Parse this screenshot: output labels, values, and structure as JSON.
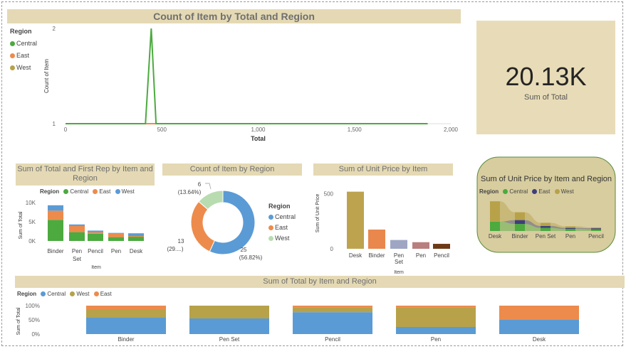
{
  "colors": {
    "central": "#5a9bd5",
    "east": "#ed8b4c",
    "west": "#b7a24a",
    "line_central": "#4caa3f",
    "line_east": "#ed8b4c",
    "line_west": "#b7a24a",
    "titlebar": "#e4d9b4"
  },
  "legend_title": "Region",
  "regions": [
    "Central",
    "East",
    "West"
  ],
  "card": {
    "value": "20.13K",
    "label": "Sum of Total"
  },
  "line_chart": {
    "title": "Count of Item by Total and Region",
    "xlabel": "Total",
    "ylabel": "Count of Item",
    "xticks": [
      "0",
      "500",
      "1,000",
      "1,500",
      "2,000"
    ],
    "yticks": [
      "1",
      "2"
    ]
  },
  "stack_chart": {
    "title": "Sum of Total and First Rep by Item and Region",
    "xlabel": "Item",
    "ylabel": "Sum of Total",
    "yticks": [
      "10K",
      "5K",
      "0K"
    ],
    "legend": [
      "Central",
      "East",
      "West"
    ],
    "categories": [
      [
        "Binder"
      ],
      [
        "Pen",
        "Set"
      ],
      [
        "Pencil"
      ],
      [
        "Pen"
      ],
      [
        "Desk"
      ]
    ]
  },
  "donut": {
    "title": "Count of Item by Region",
    "labels": [
      {
        "count": "6",
        "pct": "(13.64%)"
      },
      {
        "count": "13",
        "pct": "(29....)"
      },
      {
        "count": "25",
        "pct": "(56.82%)"
      }
    ]
  },
  "unit_bar": {
    "title": "Sum of Unit Price by Item",
    "ylabel": "Sum of Unit Price",
    "xlabel": "Item",
    "yticks": [
      "500",
      "0"
    ],
    "categories": [
      [
        "Desk"
      ],
      [
        "Binder"
      ],
      [
        "Pen",
        "Set"
      ],
      [
        "Pen"
      ],
      [
        "Pencil"
      ]
    ]
  },
  "ribbon": {
    "title": "Sum of Unit Price by Item and Region",
    "legend": [
      "Central",
      "East",
      "West"
    ],
    "categories": [
      "Desk",
      "Binder",
      "Pen Set",
      "Pen",
      "Pencil"
    ]
  },
  "hundred_chart": {
    "title": "Sum of Total by Item and Region",
    "legend": [
      "Central",
      "West",
      "East"
    ],
    "ylabel": "Sum of Total",
    "yticks": [
      "100%",
      "50%",
      "0%"
    ],
    "categories": [
      "Binder",
      "Pen Set",
      "Pencil",
      "Pen",
      "Desk"
    ]
  },
  "chart_data": [
    {
      "type": "line",
      "title": "Count of Item by Total and Region",
      "xlabel": "Total",
      "ylabel": "Count of Item",
      "xlim": [
        0,
        2000
      ],
      "ylim": [
        1,
        2
      ],
      "series": [
        {
          "name": "Central",
          "x": [
            0,
            415,
            445,
            470,
            1880
          ],
          "y": [
            1,
            1,
            2,
            1,
            1
          ]
        },
        {
          "name": "East",
          "x": [
            0,
            1540
          ],
          "y": [
            1,
            1
          ]
        },
        {
          "name": "West",
          "x": [
            0,
            1600
          ],
          "y": [
            1,
            1
          ]
        }
      ]
    },
    {
      "type": "bar",
      "stacked": true,
      "title": "Sum of Total and First Rep by Item and Region",
      "xlabel": "Item",
      "ylabel": "Sum of Total",
      "ylim": [
        0,
        10000
      ],
      "categories": [
        "Binder",
        "Pen Set",
        "Pencil",
        "Pen",
        "Desk"
      ],
      "series": [
        {
          "name": "Central",
          "values": [
            5500,
            2300,
            1900,
            1000,
            1100
          ]
        },
        {
          "name": "East",
          "values": [
            2400,
            1600,
            400,
            900,
            200
          ]
        },
        {
          "name": "West",
          "values": [
            1400,
            400,
            400,
            200,
            700
          ]
        }
      ]
    },
    {
      "type": "pie",
      "donut": true,
      "title": "Count of Item by Region",
      "series": [
        {
          "name": "Central",
          "values": [
            25
          ]
        },
        {
          "name": "East",
          "values": [
            13
          ]
        },
        {
          "name": "West",
          "values": [
            6
          ]
        }
      ],
      "categories": [
        "Central",
        "East",
        "West"
      ],
      "values": [
        25,
        13,
        6
      ]
    },
    {
      "type": "bar",
      "title": "Sum of Unit Price by Item",
      "xlabel": "Item",
      "ylabel": "Sum of Unit Price",
      "ylim": [
        0,
        550
      ],
      "categories": [
        "Desk",
        "Binder",
        "Pen Set",
        "Pen",
        "Pencil"
      ],
      "values": [
        520,
        175,
        80,
        60,
        45
      ]
    },
    {
      "type": "area",
      "stacked": true,
      "title": "Sum of Unit Price by Item and Region",
      "categories": [
        "Desk",
        "Binder",
        "Pen Set",
        "Pen",
        "Pencil"
      ],
      "series": [
        {
          "name": "Central",
          "values": [
            120,
            90,
            40,
            25,
            20
          ]
        },
        {
          "name": "East",
          "values": [
            0,
            50,
            25,
            15,
            15
          ]
        },
        {
          "name": "West",
          "values": [
            260,
            100,
            40,
            20,
            10
          ]
        }
      ]
    },
    {
      "type": "bar",
      "stacked": true,
      "percent": true,
      "title": "Sum of Total by Item and Region",
      "ylabel": "Sum of Total",
      "ylim": [
        0,
        100
      ],
      "categories": [
        "Binder",
        "Pen Set",
        "Pencil",
        "Pen",
        "Desk"
      ],
      "series": [
        {
          "name": "Central",
          "values": [
            59,
            55,
            77,
            25,
            50
          ]
        },
        {
          "name": "West",
          "values": [
            26,
            45,
            17,
            69,
            0
          ]
        },
        {
          "name": "East",
          "values": [
            15,
            0,
            6,
            6,
            50
          ]
        }
      ]
    }
  ]
}
